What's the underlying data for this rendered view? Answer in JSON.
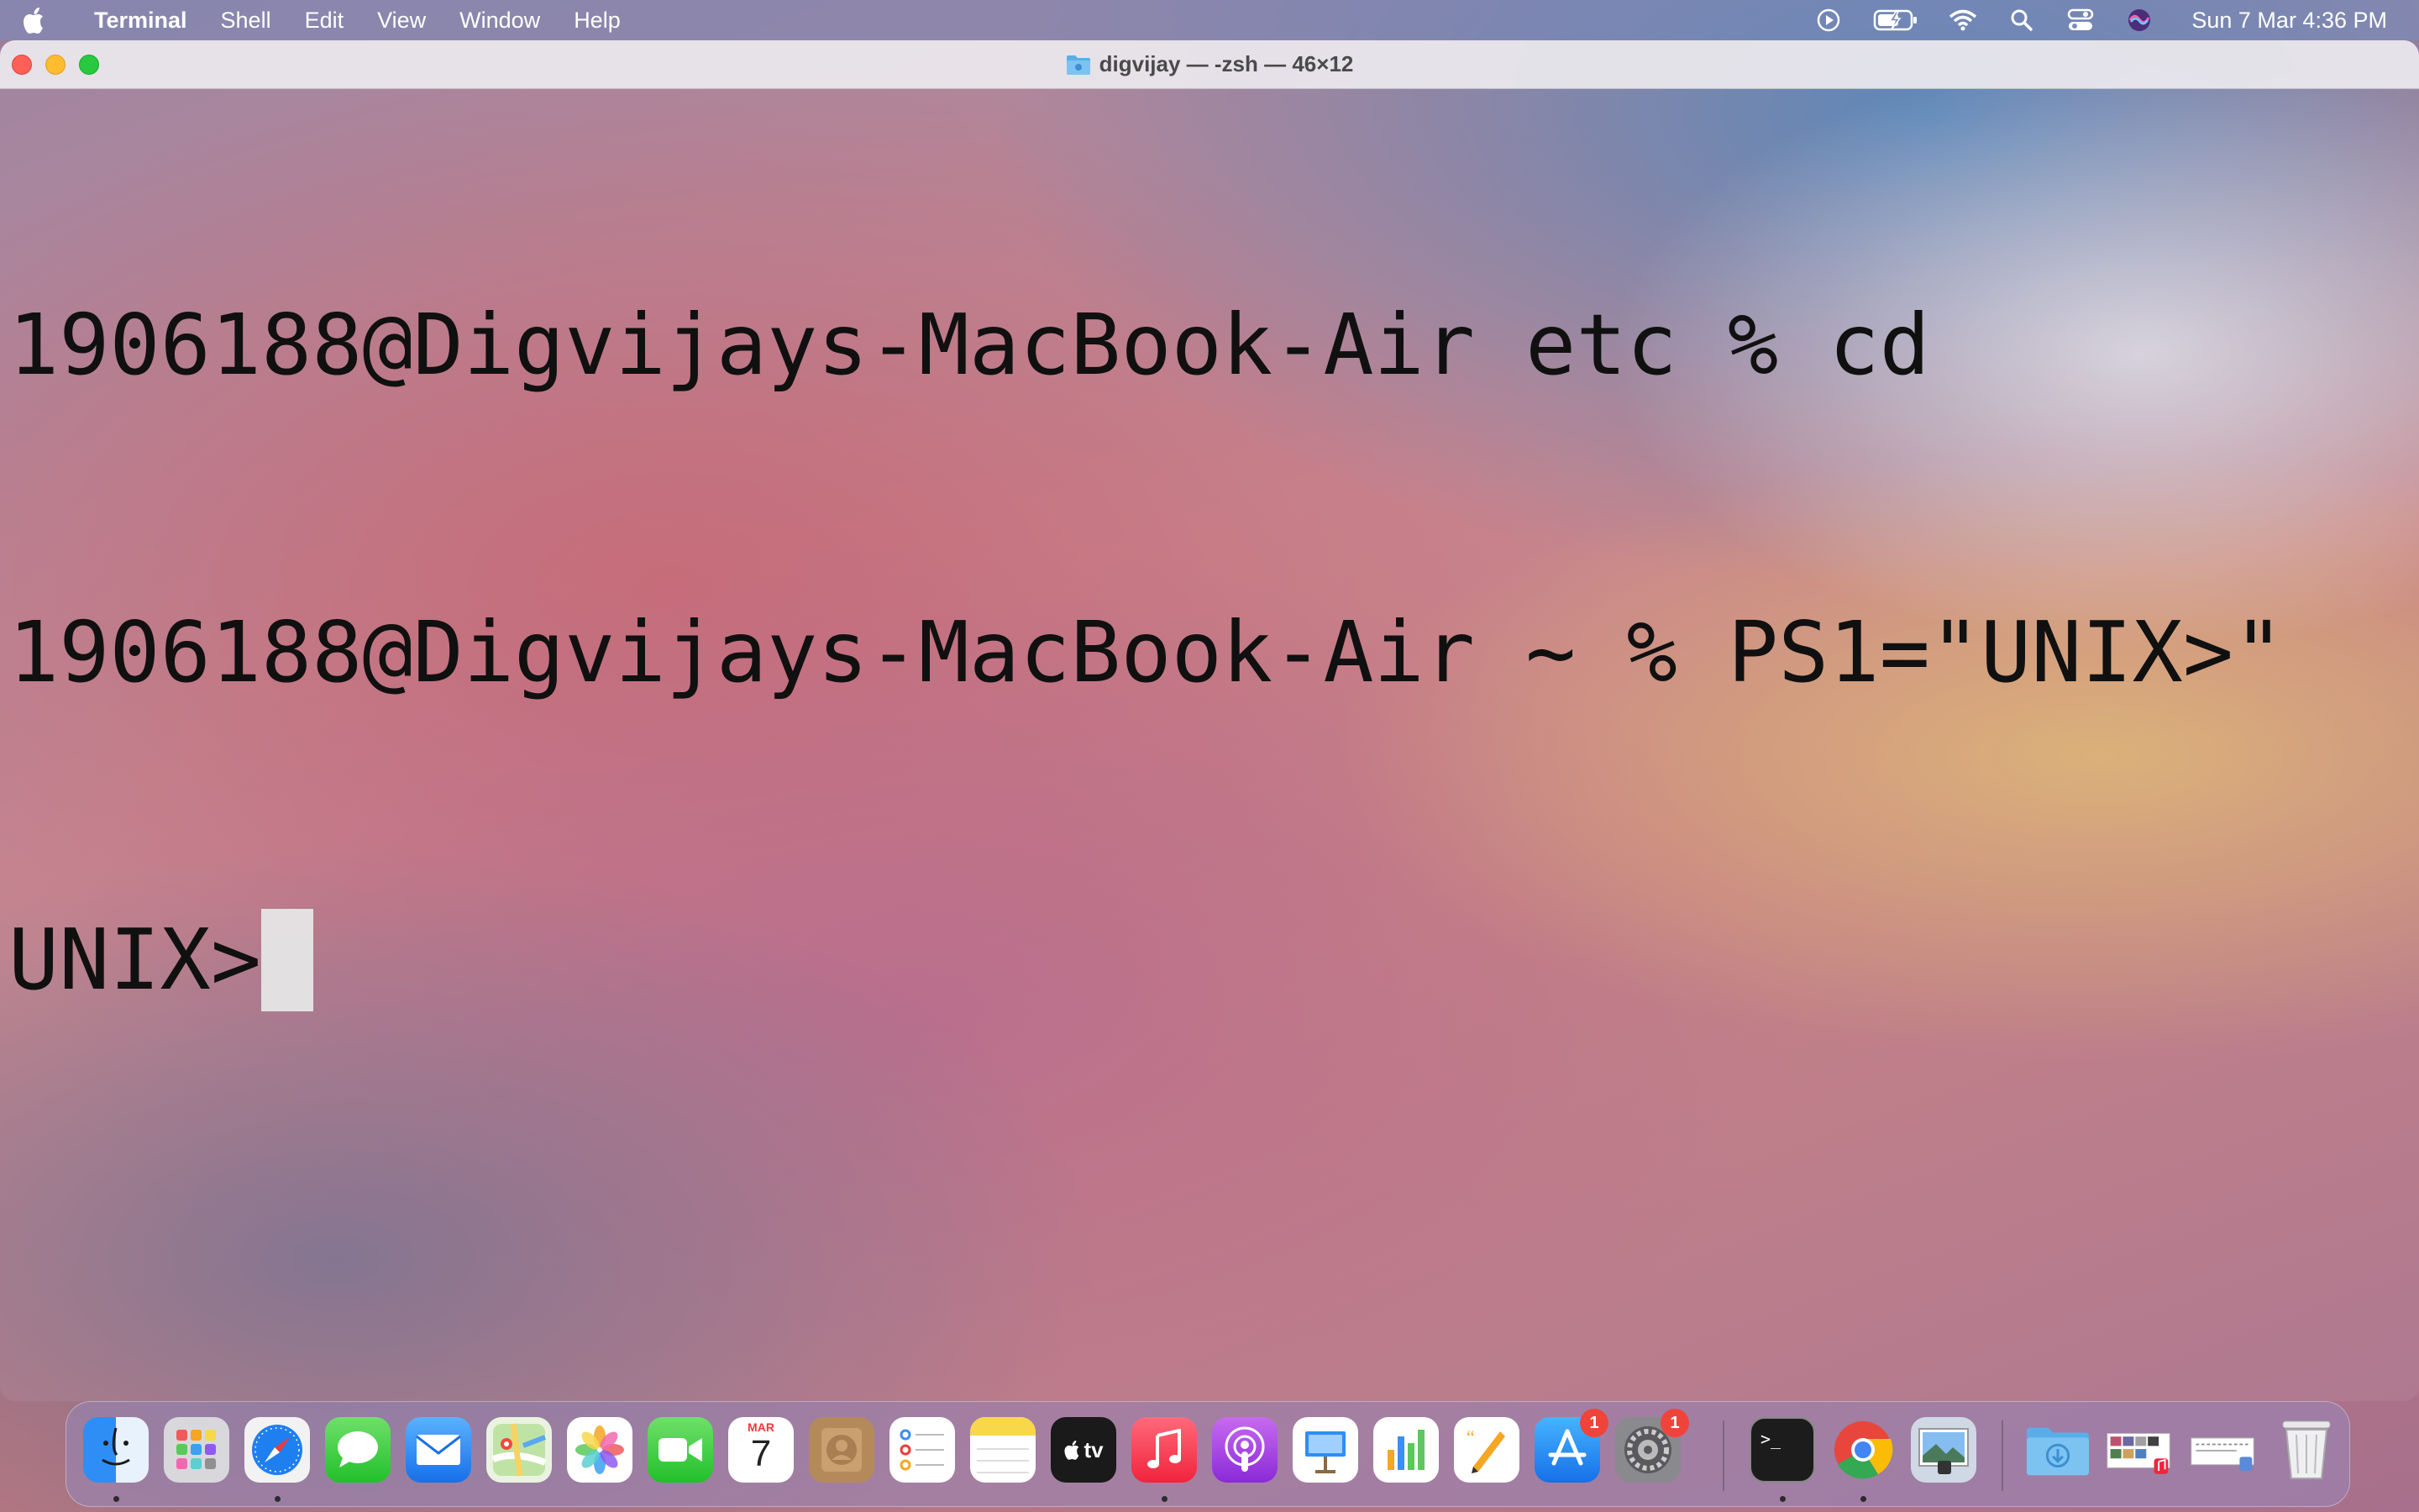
{
  "menubar": {
    "app_name": "Terminal",
    "items": [
      "Shell",
      "Edit",
      "View",
      "Window",
      "Help"
    ],
    "clock": "Sun 7 Mar  4:36 PM",
    "status_icons": [
      "screen-record-icon",
      "battery-charging-icon",
      "wifi-icon",
      "spotlight-search-icon",
      "control-center-icon",
      "siri-icon"
    ]
  },
  "window": {
    "title": "digvijay — -zsh — 46×12",
    "lines": [
      "1906188@Digvijays-MacBook-Air etc % cd",
      "1906188@Digvijays-MacBook-Air ~ % PS1=\"UNIX>\"",
      "UNIX>"
    ]
  },
  "dock": {
    "calendar_month": "MAR",
    "calendar_day": "7",
    "tv_label": "tv",
    "appstore_badge": "1",
    "settings_badge": "1",
    "apps": [
      "Finder",
      "Launchpad",
      "Safari",
      "Messages",
      "Mail",
      "Maps",
      "Photos",
      "FaceTime",
      "Calendar",
      "Contacts",
      "Reminders",
      "Notes",
      "TV",
      "Music",
      "Podcasts",
      "Keynote",
      "Numbers",
      "Pages",
      "App Store",
      "System Preferences",
      "Terminal",
      "Google Chrome",
      "Preview",
      "Downloads",
      "Recent Items",
      "Documents",
      "Trash"
    ]
  }
}
